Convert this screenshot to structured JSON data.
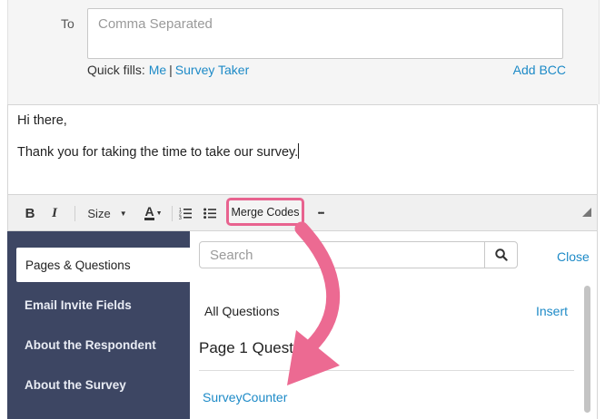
{
  "recipients": {
    "to_label": "To",
    "to_placeholder": "Comma Separated",
    "quick_fills_label": "Quick fills:",
    "quick_fills": [
      "Me",
      "Survey Taker"
    ],
    "add_bcc": "Add BCC"
  },
  "editor": {
    "lines": [
      "Hi there,",
      "Thank you for taking the time to take our survey."
    ]
  },
  "toolbar": {
    "bold": "B",
    "italic": "I",
    "size": "Size",
    "font_color": "A",
    "merge_codes": "Merge Codes",
    "more": "•••",
    "icons": [
      "bold-icon",
      "italic-icon",
      "size-dropdown",
      "font-color-icon",
      "numbered-list-icon",
      "bulleted-list-icon",
      "more-icon",
      "resize-corner-icon"
    ]
  },
  "sidebar": {
    "items": [
      {
        "label": "Pages & Questions",
        "active": true
      },
      {
        "label": "Email Invite Fields",
        "active": false
      },
      {
        "label": "About the Respondent",
        "active": false
      },
      {
        "label": "About the Survey",
        "active": false
      }
    ]
  },
  "merge_panel": {
    "search_placeholder": "Search",
    "close": "Close",
    "all_questions": "All Questions",
    "insert": "Insert",
    "page_heading": "Page 1 Quest",
    "items": [
      "SurveyCounter"
    ]
  },
  "colors": {
    "accent_link": "#1d8ac7",
    "sidebar_bg": "#3d4663",
    "highlight": "#e8638f"
  }
}
